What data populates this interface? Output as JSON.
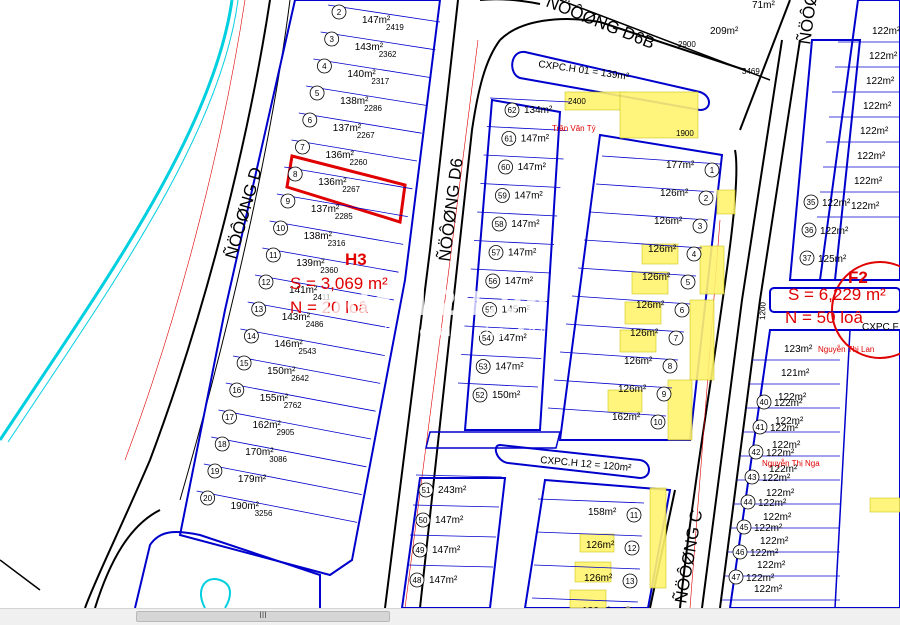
{
  "streets": {
    "d": "ÑÖÔØNG D",
    "d6": "ÑÖÔØNG D6",
    "d6b": "ÑÖÔØNG D6B",
    "c": "ÑÖÔØNG C"
  },
  "blocks": {
    "h3": {
      "name": "H3",
      "area": "S = 3,069 m²",
      "count": "N = 20 loâ"
    },
    "f2": {
      "name": "F2",
      "area": "S = 6,229 m²",
      "count": "N = 50 loâ",
      "road": "CXPC.F"
    }
  },
  "cxpc": {
    "h01": "CXPC.H 01 = 139m²",
    "h12": "CXPC.H 12 = 120m²"
  },
  "h3_lots": [
    {
      "n": "2",
      "area": "147m²",
      "w": "2419"
    },
    {
      "n": "3",
      "area": "143m²",
      "w": "2362"
    },
    {
      "n": "4",
      "area": "140m²",
      "w": "2317"
    },
    {
      "n": "5",
      "area": "138m²",
      "w": "2286"
    },
    {
      "n": "6",
      "area": "137m²",
      "w": "2267"
    },
    {
      "n": "7",
      "area": "136m²",
      "w": "2260"
    },
    {
      "n": "8",
      "area": "136m²",
      "w": "2267"
    },
    {
      "n": "9",
      "area": "137m²",
      "w": "2285"
    },
    {
      "n": "10",
      "area": "138m²",
      "w": "2316"
    },
    {
      "n": "11",
      "area": "139m²",
      "w": "2360"
    },
    {
      "n": "12",
      "area": "141m²",
      "w": "2411"
    },
    {
      "n": "13",
      "area": "143m²",
      "w": "2486"
    },
    {
      "n": "14",
      "area": "146m²",
      "w": "2543"
    },
    {
      "n": "15",
      "area": "150m²",
      "w": "2642"
    },
    {
      "n": "16",
      "area": "155m²",
      "w": "2762"
    },
    {
      "n": "17",
      "area": "162m²",
      "w": "2905"
    },
    {
      "n": "18",
      "area": "170m²",
      "w": "3086"
    },
    {
      "n": "19",
      "area": "179m²",
      "w": ""
    },
    {
      "n": "20",
      "area": "190m²",
      "w": "3256"
    }
  ],
  "west_lots": [
    {
      "n": "62",
      "area": "134m²"
    },
    {
      "n": "61",
      "area": "147m²"
    },
    {
      "n": "60",
      "area": "147m²"
    },
    {
      "n": "59",
      "area": "147m²"
    },
    {
      "n": "58",
      "area": "147m²"
    },
    {
      "n": "57",
      "area": "147m²"
    },
    {
      "n": "56",
      "area": "147m²"
    },
    {
      "n": "55",
      "area": "145m²"
    },
    {
      "n": "54",
      "area": "147m²"
    },
    {
      "n": "53",
      "area": "147m²"
    },
    {
      "n": "52",
      "area": "150m²"
    }
  ],
  "east_lots": [
    {
      "n": "1",
      "area": "177m²"
    },
    {
      "n": "2",
      "area": "126m²"
    },
    {
      "n": "3",
      "area": "126m²"
    },
    {
      "n": "4",
      "area": "126m²"
    },
    {
      "n": "5",
      "area": "126m²"
    },
    {
      "n": "6",
      "area": "126m²"
    },
    {
      "n": "7",
      "area": "126m²"
    },
    {
      "n": "8",
      "area": "126m²"
    },
    {
      "n": "9",
      "area": "126m²"
    },
    {
      "n": "10",
      "area": "162m²"
    }
  ],
  "south_west_lots": [
    {
      "n": "51",
      "area": "243m²"
    },
    {
      "n": "50",
      "area": "147m²"
    },
    {
      "n": "49",
      "area": "147m²"
    },
    {
      "n": "48",
      "area": "147m²"
    }
  ],
  "south_east_lots": [
    {
      "n": "11",
      "area": "158m²"
    },
    {
      "n": "12",
      "area": "126m²"
    },
    {
      "n": "13",
      "area": "126m²"
    },
    {
      "n": "14",
      "area": "126m²"
    }
  ],
  "f2_upper": [
    {
      "n": "",
      "area": "122m²"
    },
    {
      "n": "",
      "area": "122m²"
    },
    {
      "n": "",
      "area": "122m²"
    },
    {
      "n": "",
      "area": "122m²"
    },
    {
      "n": "",
      "area": "122m²"
    },
    {
      "n": "",
      "area": "122m²"
    },
    {
      "n": "",
      "area": "122m²"
    },
    {
      "n": "",
      "area": "122m²"
    }
  ],
  "f2_lower": [
    {
      "n": "",
      "area": "123m²"
    },
    {
      "n": "",
      "area": "121m²"
    },
    {
      "n": "",
      "area": "122m²"
    },
    {
      "n": "",
      "area": "122m²"
    },
    {
      "n": "",
      "area": "122m²"
    },
    {
      "n": "",
      "area": "122m²"
    },
    {
      "n": "",
      "area": "122m²"
    },
    {
      "n": "",
      "area": "122m²"
    },
    {
      "n": "",
      "area": "122m²"
    },
    {
      "n": "",
      "area": "122m²"
    },
    {
      "n": "",
      "area": "122m²"
    }
  ],
  "f2_west_lots": [
    {
      "n": "35",
      "area": "122m²"
    },
    {
      "n": "36",
      "area": "122m²"
    },
    {
      "n": "37",
      "area": "125m²"
    }
  ],
  "f2_west_lower": [
    {
      "n": "40",
      "area": "122m²"
    },
    {
      "n": "41",
      "area": "122m²"
    },
    {
      "n": "42",
      "area": "122m²"
    },
    {
      "n": "43",
      "area": "122m²"
    },
    {
      "n": "44",
      "area": "122m²"
    },
    {
      "n": "45",
      "area": "122m²"
    },
    {
      "n": "46",
      "area": "122m²"
    },
    {
      "n": "47",
      "area": "122m²"
    }
  ],
  "top_lots": {
    "a": "209m²",
    "b": "71m²"
  },
  "dims": {
    "d2900": "2900",
    "d3469": "3469",
    "d2400": "2400",
    "d1900": "1900",
    "d1200": "1200"
  },
  "owners": {
    "tran_van_ty": "Trần Văn Tý",
    "nguyen_thi_nga": "Nguyễn Thị Nga",
    "nguyen_thi_lan": "Nguyễn Thị Lan"
  },
  "watermark": {
    "main": "bds 123.vn",
    "sub": "kênh thông tin nhà đất"
  },
  "scrollbar": {
    "grip": "III"
  },
  "colors": {
    "lot_line": "#0000cc",
    "highlight": "#fff36e",
    "road_edge": "#000000",
    "canal": "#00cfe0",
    "red": "#e00000"
  }
}
